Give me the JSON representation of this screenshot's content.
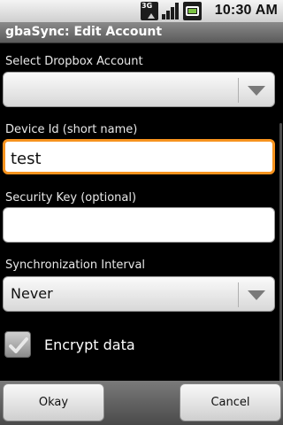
{
  "status_bar": {
    "time": "10:30 AM",
    "network_label": "3G",
    "icons": [
      "3g-data-icon",
      "signal-strength-icon",
      "battery-charging-icon"
    ]
  },
  "title_bar": {
    "title": "gbaSync: Edit Account"
  },
  "form": {
    "dropbox_account": {
      "label": "Select Dropbox Account",
      "value": ""
    },
    "device_id": {
      "label": "Device Id (short name)",
      "value": "test"
    },
    "security_key": {
      "label": "Security Key (optional)",
      "value": ""
    },
    "sync_interval": {
      "label": "Synchronization Interval",
      "value": "Never"
    },
    "encrypt": {
      "label": "Encrypt data",
      "checked": true
    }
  },
  "buttons": {
    "okay": "Okay",
    "cancel": "Cancel"
  },
  "colors": {
    "focus_accent": "#f7931e",
    "battery": "#7bc143"
  }
}
